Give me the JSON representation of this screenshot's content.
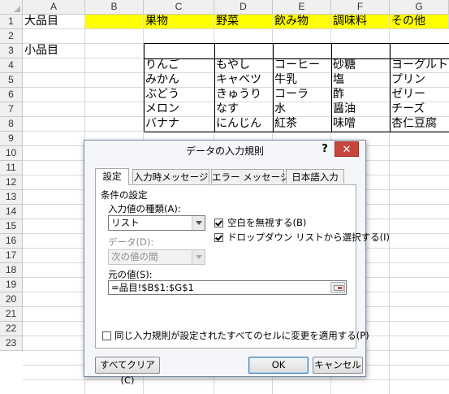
{
  "sheet": {
    "columns": [
      "A",
      "B",
      "C",
      "D",
      "E",
      "F",
      "G"
    ],
    "rows": [
      "1",
      "2",
      "3",
      "4",
      "5",
      "6",
      "7",
      "8",
      "9",
      "10",
      "11",
      "12",
      "13",
      "14",
      "15",
      "16",
      "17",
      "18",
      "19",
      "20",
      "21",
      "22",
      "23"
    ],
    "a1": "大品目",
    "a3": "小品目",
    "categories": [
      "果物",
      "野菜",
      "飲み物",
      "調味料",
      "その他"
    ],
    "items": [
      [
        "りんご",
        "もやし",
        "コーヒー",
        "砂糖",
        "ヨーグルト"
      ],
      [
        "みかん",
        "キャベツ",
        "牛乳",
        "塩",
        "プリン"
      ],
      [
        "ぶどう",
        "きゅうり",
        "コーラ",
        "酢",
        "ゼリー"
      ],
      [
        "メロン",
        "なす",
        "水",
        "醤油",
        "チーズ"
      ],
      [
        "バナナ",
        "にんじん",
        "紅茶",
        "味噌",
        "杏仁豆腐"
      ]
    ]
  },
  "dialog": {
    "title": "データの入力規則",
    "help": "?",
    "close": "✕",
    "tabs": [
      "設定",
      "入力時メッセージ",
      "エラー メッセージ",
      "日本語入力"
    ],
    "section": "条件の設定",
    "allow_label": "入力値の種類(A):",
    "allow_value": "リスト",
    "ignore_blank": "空白を無視する(B)",
    "dropdown": "ドロップダウン リストから選択する(I)",
    "data_label": "データ(D):",
    "data_value": "次の値の間",
    "source_label": "元の値(S):",
    "source_value": "=品目!$B$1:$G$1",
    "apply_all": "同じ入力規則が設定されたすべてのセルに変更を適用する(P)",
    "clear_all": "すべてクリア(C)",
    "ok": "OK",
    "cancel": "キャンセル"
  }
}
